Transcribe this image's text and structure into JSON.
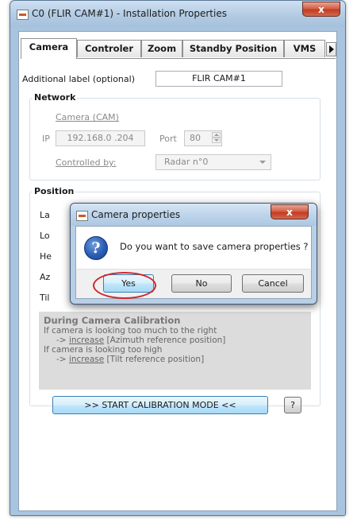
{
  "window": {
    "title": "C0 (FLIR CAM#1) - Installation Properties",
    "close_glyph": "x"
  },
  "tabs": [
    {
      "label": "Camera",
      "active": true
    },
    {
      "label": "Controler",
      "active": false
    },
    {
      "label": "Zoom",
      "active": false
    },
    {
      "label": "Standby Position",
      "active": false
    },
    {
      "label": "VMS",
      "active": false
    }
  ],
  "camera_tab": {
    "additional_label": {
      "label": "Additional label (optional)",
      "value": "FLIR CAM#1"
    },
    "network": {
      "title": "Network",
      "camera_link": "Camera (CAM)",
      "ip_label": "IP",
      "ip_value": "192.168.0 .204",
      "port_label": "Port",
      "port_value": "80",
      "controlled_by_label": "Controlled by:",
      "controlled_by_value": "Radar n°0"
    },
    "position": {
      "title": "Position",
      "row_labels": [
        "La",
        "Lo",
        "He",
        "Az",
        "Til"
      ]
    },
    "calibration_help": {
      "heading": "During Camera Calibration",
      "line1": "If camera is looking too much to the right",
      "line2_prefix": "-> ",
      "line2_link": "increase",
      "line2_suffix": " [Azimuth reference position]",
      "line3": "If camera is looking too high",
      "line4_prefix": "-> ",
      "line4_link": "increase",
      "line4_suffix": " [Tilt reference position]"
    },
    "start_calibration_button": ">> START CALIBRATION MODE <<",
    "help_button": "?"
  },
  "dialog": {
    "title": "Camera properties",
    "close_glyph": "x",
    "icon_glyph": "?",
    "message": "Do you want to save camera properties ?",
    "buttons": {
      "yes": "Yes",
      "no": "No",
      "cancel": "Cancel"
    }
  },
  "colors": {
    "frame": "#a9c4de",
    "close_red": "#c23b22",
    "highlight_ring": "#d0262a",
    "focused_button": "#3c7fb1"
  }
}
